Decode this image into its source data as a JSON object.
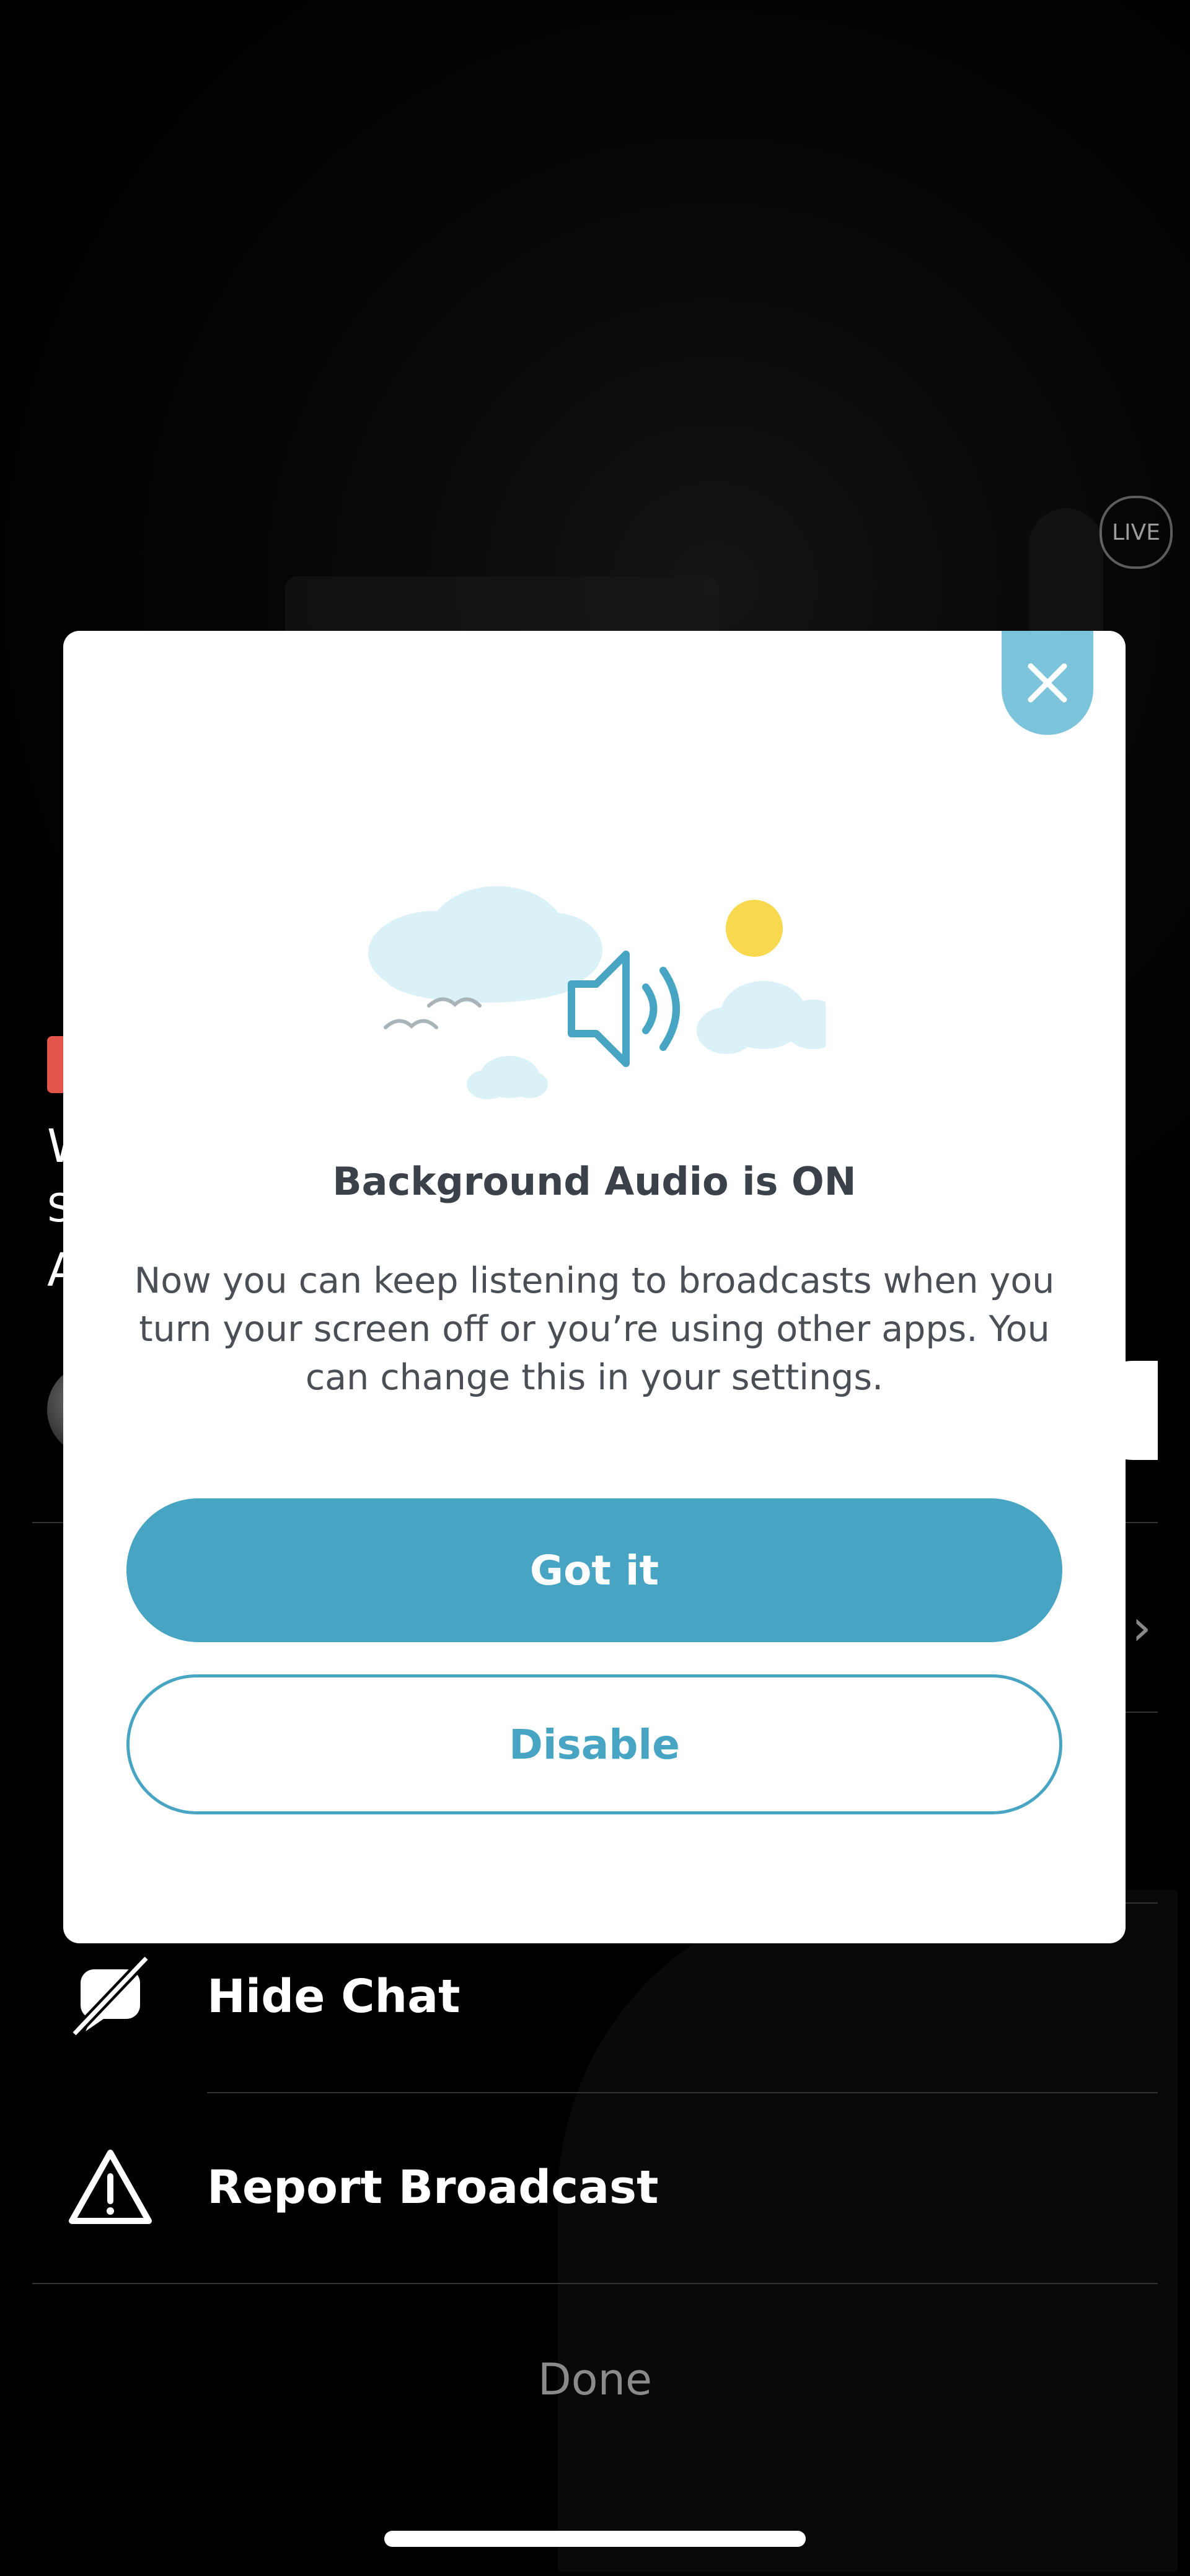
{
  "background": {
    "live_logo_text": "LIVE",
    "title_line1": "W",
    "title_line2": "S",
    "title_line3": "A",
    "actions": [
      {
        "label": "Hide Chat",
        "icon": "chat-off-icon"
      },
      {
        "label": "Report Broadcast",
        "icon": "warning-icon"
      }
    ],
    "done_label": "Done"
  },
  "modal": {
    "close_icon": "close-icon",
    "illustration_icon": "speaker-icon",
    "title": "Background Audio is ON",
    "body": "Now you can keep listening to broadcasts when you turn your screen off or you’re using other apps. You can change this in your settings.",
    "primary_label": "Got it",
    "secondary_label": "Disable"
  },
  "colors": {
    "accent": "#47a4c3",
    "close_bg": "#7cc4dc",
    "cloud": "#d9f1f7",
    "sun": "#f7d84e",
    "live_red": "#e3554a"
  }
}
